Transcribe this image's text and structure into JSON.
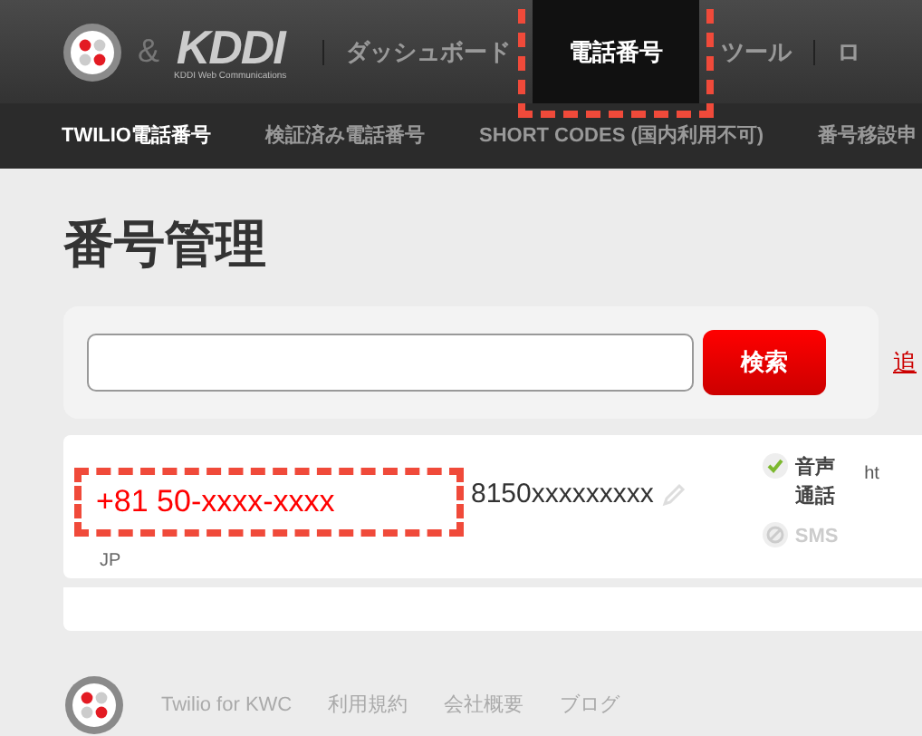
{
  "header": {
    "partner_mark": "&",
    "brand": "KDDI",
    "brand_sub": "KDDI Web Communications",
    "nav": [
      {
        "label": "ダッシュボード",
        "selected": false,
        "highlighted": false
      },
      {
        "label": "電話番号",
        "selected": true,
        "highlighted": true
      },
      {
        "label": "ツール",
        "selected": false,
        "highlighted": false
      },
      {
        "label": "ロ",
        "selected": false,
        "highlighted": false
      }
    ]
  },
  "subnav": [
    {
      "label": "TWILIO電話番号",
      "selected": true
    },
    {
      "label": "検証済み電話番号",
      "selected": false
    },
    {
      "label": "SHORT CODES (国内利用不可)",
      "selected": false
    },
    {
      "label": "番号移設申",
      "selected": false
    }
  ],
  "page_title": "番号管理",
  "search": {
    "button": "検索",
    "link": "追"
  },
  "numbers": [
    {
      "number": "+81 50-xxxx-xxxx",
      "country": "JP",
      "highlighted": true,
      "friendly_name": "8150xxxxxxxxx",
      "capabilities": [
        {
          "label": "音声通話",
          "enabled": true
        },
        {
          "label": "SMS",
          "enabled": false
        }
      ],
      "url": "ht"
    }
  ],
  "footer": [
    "Twilio for KWC",
    "利用規約",
    "会社概要",
    "ブログ"
  ]
}
